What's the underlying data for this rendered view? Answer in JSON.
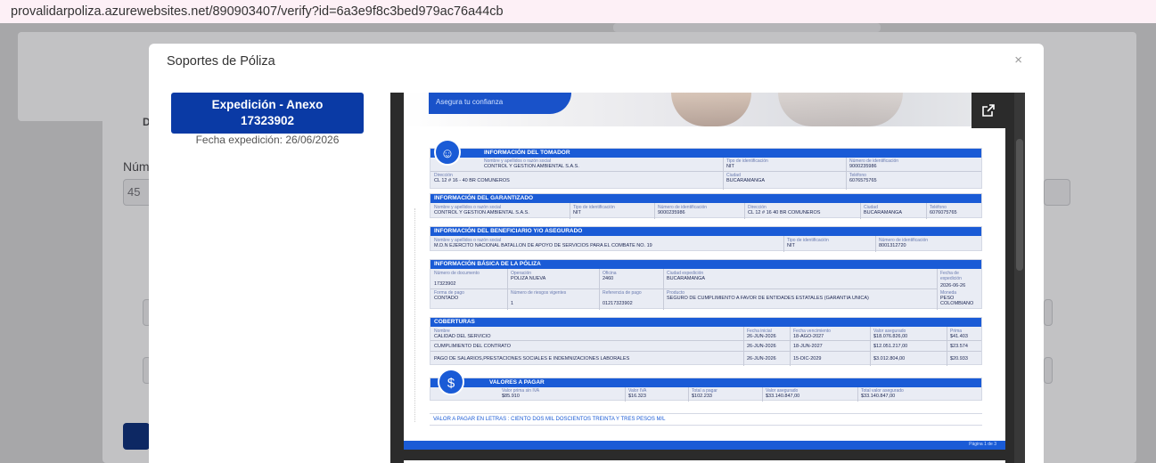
{
  "browser": {
    "url": "provalidarpoliza.azurewebsites.net/890903407/verify?id=6a3e9f8c3bed979ac76a44cb"
  },
  "background": {
    "tab_label": "D",
    "field_label": "Núm",
    "field_value": "45"
  },
  "modal": {
    "title": "Soportes de Póliza",
    "close": "×",
    "documents": [
      {
        "title": "Expedición - Anexo",
        "number": "17323902",
        "date": "Fecha expedición: 26/06/2026"
      }
    ]
  },
  "viewer": {
    "popout_icon": "external-link-icon",
    "banner_text": "Asegura tu confianza",
    "tomador": {
      "heading": "INFORMACIÓN DEL TOMADOR",
      "fields": [
        {
          "label": "Nombre y apellidos o razón social",
          "value": "CONTROL Y GESTION AMBIENTAL S.A.S."
        },
        {
          "label": "Tipo de identificación",
          "value": "NIT"
        },
        {
          "label": "Número de identificación",
          "value": "9000235986"
        },
        {
          "label": "Dirección",
          "value": "CL 12 # 16 - 40 BR COMUNEROS"
        },
        {
          "label": "Ciudad",
          "value": "BUCARAMANGA"
        },
        {
          "label": "Teléfono",
          "value": "6076575765"
        }
      ]
    },
    "garantizado": {
      "heading": "INFORMACIÓN DEL GARANTIZADO",
      "fields": [
        {
          "label": "Nombre y apellidos o razón social",
          "value": "CONTROL Y GESTION AMBIENTAL S.A.S."
        },
        {
          "label": "Tipo de identificación",
          "value": "NIT"
        },
        {
          "label": "Número de identificación",
          "value": "9000235986"
        },
        {
          "label": "Dirección",
          "value": "CL 12 # 16 40 BR COMUNEROS"
        },
        {
          "label": "Ciudad",
          "value": "BUCARAMANGA"
        },
        {
          "label": "Teléfono",
          "value": "6076075765"
        }
      ]
    },
    "beneficiario": {
      "heading": "INFORMACIÓN DEL BENEFICIARIO Y/O ASEGURADO",
      "fields": [
        {
          "label": "Nombre y apellidos o razón social",
          "value": "M.D.N EJERCITO NACIONAL BATALLON DE APOYO DE SERVICIOS PARA EL COMBATE NO. 19"
        },
        {
          "label": "Tipo de identificación",
          "value": "NIT"
        },
        {
          "label": "Número de identificación",
          "value": "8001312720"
        }
      ]
    },
    "poliza": {
      "heading": "INFORMACIÓN BÁSICA DE LA PÓLIZA",
      "fields": [
        {
          "label": "Número de documento",
          "value": "17323902"
        },
        {
          "label": "Operación",
          "value": "POLIZA NUEVA"
        },
        {
          "label": "Oficina",
          "value": "2460"
        },
        {
          "label": "Ciudad expedición",
          "value": "BUCARAMANGA"
        },
        {
          "label": "Fecha de expedición",
          "value": "2026-06-26"
        },
        {
          "label": "Forma de pago",
          "value": "CONTADO"
        },
        {
          "label": "Número de riesgos vigentes",
          "value": "1"
        },
        {
          "label": "Referencia de pago",
          "value": "01217323902"
        },
        {
          "label": "Producto",
          "value": "SEGURO DE CUMPLIMIENTO A FAVOR DE ENTIDADES ESTATALES (GARANTIA UNICA)"
        },
        {
          "label": "Moneda",
          "value": "PESO COLOMBIANO"
        }
      ]
    },
    "coberturas": {
      "heading": "COBERTURAS",
      "columns": [
        "Nombre",
        "Fecha inicial",
        "Fecha vencimiento",
        "Valor asegurado",
        "Prima"
      ],
      "rows": [
        [
          "CALIDAD DEL SERVICIO",
          "26-JUN-2026",
          "18-AGO-2027",
          "$18.076.826,00",
          "$41.403"
        ],
        [
          "CUMPLIMIENTO DEL CONTRATO",
          "26-JUN-2026",
          "18-JUN-2027",
          "$12.051.217,00",
          "$23.574"
        ],
        [
          "PAGO DE SALARIOS,PRESTACIONES SOCIALES E INDEMNIZACIONES LABORALES",
          "26-JUN-2026",
          "15-DIC-2029",
          "$3.012.804,00",
          "$20.933"
        ]
      ]
    },
    "valores": {
      "heading": "VALORES A PAGAR",
      "fields": [
        {
          "label": "Valor prima sin IVA",
          "value": "$85.910"
        },
        {
          "label": "Valor IVA",
          "value": "$16.323"
        },
        {
          "label": "Total a pagar",
          "value": "$102.233"
        },
        {
          "label": "Valor asegurado",
          "value": "$33.140.847,00"
        },
        {
          "label": "Total valor asegurado",
          "value": "$33.140.847,00"
        }
      ]
    },
    "in_words": "VALOR A PAGAR EN LETRAS : CIENTO DOS MIL DOSCIENTOS TREINTA Y TRES PESOS M/L",
    "page_number": "Página 1 de 3"
  }
}
